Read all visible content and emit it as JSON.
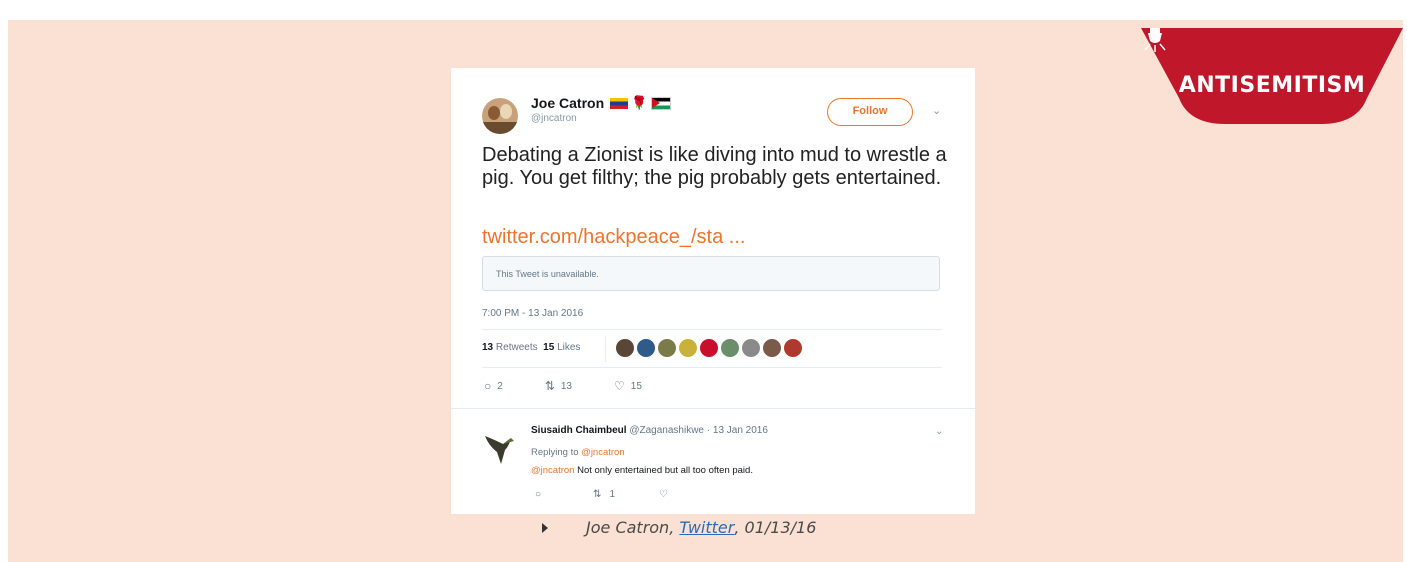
{
  "badge": {
    "label": "ANTISEMITISM",
    "icon": "lamp-icon",
    "color": "#c0172a"
  },
  "tweet": {
    "author_name": "Joe Catron",
    "author_handle": "@jncatron",
    "follow_label": "Follow",
    "text": "Debating a Zionist is like diving into mud to wrestle a pig. You get filthy; the pig probably gets entertained.",
    "link": "twitter.com/hackpeace_/sta ...",
    "quoted_unavailable": "This Tweet is unavailable.",
    "timestamp": "7:00 PM - 13 Jan 2016",
    "retweets_count": "13",
    "retweets_label": "Retweets",
    "likes_count": "15",
    "likes_label": "Likes",
    "reply_count": "2",
    "retweet_action_count": "13",
    "like_action_count": "15"
  },
  "reply": {
    "author_name": "Siusaidh Chaimbeul",
    "author_meta": "@Zaganashikwe · 13 Jan 2016",
    "replying_prefix": "Replying to",
    "replying_handle": "@jncatron",
    "mention": "@jncatron",
    "text": "Not only entertained but all too often paid.",
    "retweet_count": "1"
  },
  "caption": {
    "author": "Joe Catron,",
    "source": "Twitter",
    "date": ", 01/13/16"
  },
  "colors": {
    "panel": "#fbe1d4",
    "accent": "#f0742b",
    "badge": "#c0172a"
  }
}
